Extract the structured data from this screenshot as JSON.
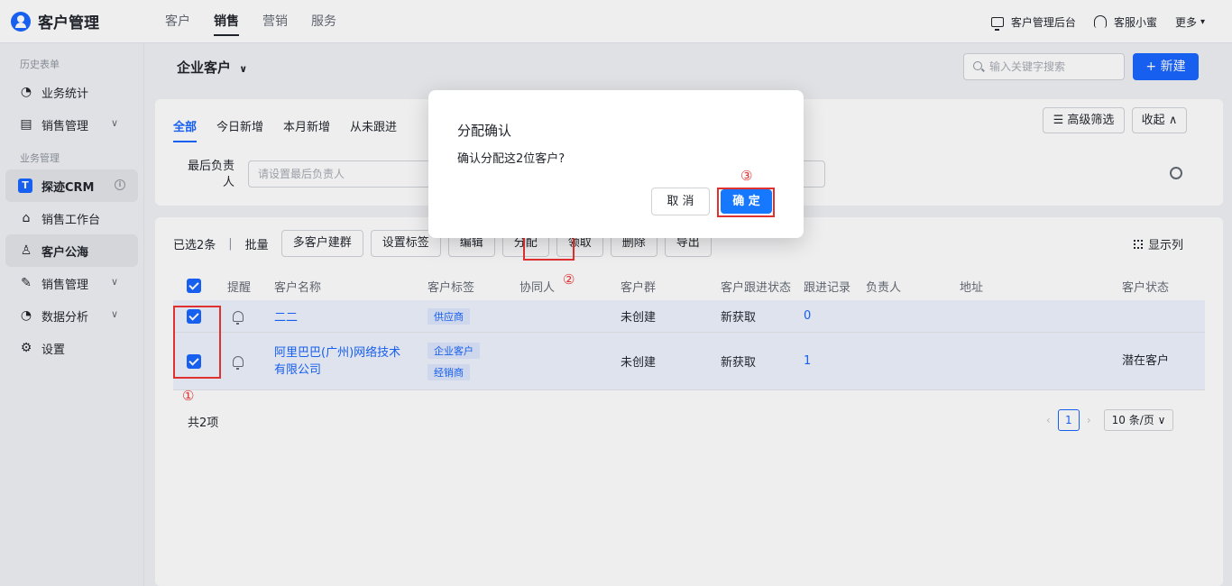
{
  "app": {
    "title": "客户管理"
  },
  "topnav": {
    "tabs": [
      "客户",
      "销售",
      "营销",
      "服务"
    ],
    "active": "销售"
  },
  "topright": {
    "admin": "客户管理后台",
    "support": "客服小蜜",
    "more": "更多"
  },
  "sidebar": {
    "group1": "历史表单",
    "group2": "业务管理",
    "items": [
      {
        "label": "业务统计",
        "icon": "pie-chart-icon"
      },
      {
        "label": "销售管理",
        "icon": "calendar-icon"
      },
      {
        "label": "探迹CRM",
        "icon": "tanji-logo-icon"
      },
      {
        "label": "销售工作台",
        "icon": "home-icon"
      },
      {
        "label": "客户公海",
        "icon": "user-icon"
      },
      {
        "label": "销售管理",
        "icon": "edit-icon"
      },
      {
        "label": "数据分析",
        "icon": "pie-chart-icon"
      },
      {
        "label": "设置",
        "icon": "gear-icon"
      }
    ]
  },
  "page": {
    "title": "企业客户",
    "search_placeholder": "输入关键字搜索",
    "new_label": "新建"
  },
  "filters": {
    "tabs": [
      "全部",
      "今日新增",
      "本月新增",
      "从未跟进"
    ],
    "advanced": "高级筛选",
    "collapse": "收起",
    "label": "最后负责人",
    "placeholder": "请设置最后负责人"
  },
  "toolbar": {
    "selected": "已选2条",
    "separator": "|",
    "batch": "批量",
    "buttons": [
      "多客户建群",
      "设置标签",
      "编辑",
      "分配",
      "领取",
      "删除",
      "导出"
    ],
    "columns": "显示列"
  },
  "table": {
    "headers": [
      "提醒",
      "客户名称",
      "客户标签",
      "协同人",
      "客户群",
      "客户跟进状态",
      "跟进记录",
      "负责人",
      "地址",
      "客户状态"
    ],
    "rows": [
      {
        "name": "二二",
        "tags": [
          "供应商"
        ],
        "group": "未创建",
        "status": "新获取",
        "records": "0",
        "state": ""
      },
      {
        "name": "阿里巴巴(广州)网络技术有限公司",
        "tags": [
          "企业客户",
          "经销商"
        ],
        "group": "未创建",
        "status": "新获取",
        "records": "1",
        "state": "潜在客户"
      }
    ],
    "total": "共2项",
    "page": "1",
    "page_size": "10 条/页"
  },
  "modal": {
    "title": "分配确认",
    "message": "确认分配这2位客户?",
    "cancel": "取 消",
    "ok": "确 定"
  },
  "annotations": [
    "①",
    "②",
    "③"
  ],
  "colors": {
    "primary": "#1664ff",
    "annotation": "#e03131"
  }
}
